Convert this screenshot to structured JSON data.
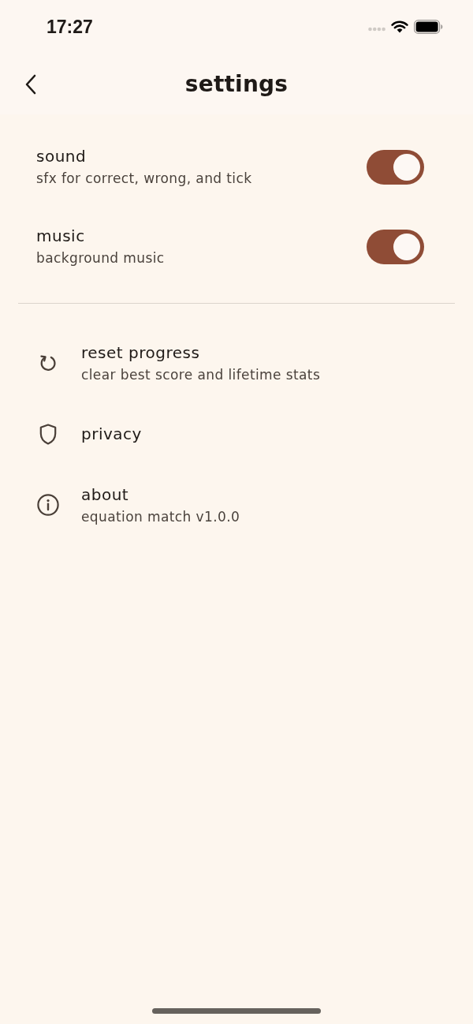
{
  "status_bar": {
    "time": "17:27"
  },
  "header": {
    "title": "settings"
  },
  "toggles": [
    {
      "title": "sound",
      "subtitle": "sfx for correct, wrong, and tick",
      "on": true
    },
    {
      "title": "music",
      "subtitle": "background music",
      "on": true
    }
  ],
  "links": [
    {
      "kind": "reset",
      "title": "reset progress",
      "subtitle": "clear best score and lifetime stats"
    },
    {
      "kind": "privacy",
      "title": "privacy"
    },
    {
      "kind": "info",
      "title": "about",
      "subtitle": "equation match v1.0.0"
    }
  ]
}
